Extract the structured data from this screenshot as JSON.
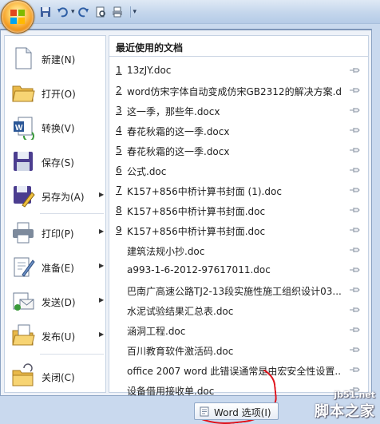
{
  "quick_access": {
    "buttons": [
      "save-icon",
      "undo-icon",
      "redo-icon",
      "print-preview-icon",
      "print-icon"
    ],
    "customize": "▾"
  },
  "commands": [
    {
      "label": "新建(N)",
      "icon": "new-document-icon",
      "submenu": false
    },
    {
      "label": "打开(O)",
      "icon": "open-folder-icon",
      "submenu": false
    },
    {
      "label": "转换(V)",
      "icon": "convert-icon",
      "submenu": false
    },
    {
      "label": "保存(S)",
      "icon": "save-icon",
      "submenu": false
    },
    {
      "label": "另存为(A)",
      "icon": "save-as-icon",
      "submenu": true
    },
    {
      "label": "打印(P)",
      "icon": "print-icon",
      "submenu": true
    },
    {
      "label": "准备(E)",
      "icon": "prepare-icon",
      "submenu": true
    },
    {
      "label": "发送(D)",
      "icon": "send-icon",
      "submenu": true
    },
    {
      "label": "发布(U)",
      "icon": "publish-icon",
      "submenu": true
    },
    {
      "label": "关闭(C)",
      "icon": "close-folder-icon",
      "submenu": false
    }
  ],
  "recent": {
    "heading": "最近使用的文档",
    "items": [
      {
        "num": "1",
        "name": "13zJY.doc"
      },
      {
        "num": "2",
        "name": "word仿宋字体自动变成仿宋GB2312的解决方案.d..."
      },
      {
        "num": "3",
        "name": "这一季，那些年.docx"
      },
      {
        "num": "4",
        "name": "春花秋霜的这一季.docx"
      },
      {
        "num": "5",
        "name": "春花秋霜的这一季.docx"
      },
      {
        "num": "6",
        "name": "公式.doc"
      },
      {
        "num": "7",
        "name": "K157+856中桥计算书封面 (1).doc"
      },
      {
        "num": "8",
        "name": "K157+856中桥计算书封面.doc"
      },
      {
        "num": "9",
        "name": "K157+856中桥计算书封面.doc"
      },
      {
        "num": "",
        "name": "建筑法规小抄.doc"
      },
      {
        "num": "",
        "name": "a993-1-6-2012-97617011.doc"
      },
      {
        "num": "",
        "name": "巴南广高速公路TJ2-13段实施性施工组织设计03...."
      },
      {
        "num": "",
        "name": "水泥试验结果汇总表.doc"
      },
      {
        "num": "",
        "name": "涵洞工程.doc"
      },
      {
        "num": "",
        "name": "百川教育软件激活码.doc"
      },
      {
        "num": "",
        "name": "office 2007 word 此错误通常是由宏安全性设置..."
      },
      {
        "num": "",
        "name": "设备借用接收单.doc"
      }
    ]
  },
  "word_options": {
    "label": "Word 选项(I)",
    "icon": "options-icon"
  },
  "watermark": {
    "site": "jb51.net",
    "brand": "脚本之家"
  },
  "colors": {
    "office_orange": "#f39a1f",
    "menu_border": "#8ba3c3",
    "annotation_red": "#e0111a"
  }
}
